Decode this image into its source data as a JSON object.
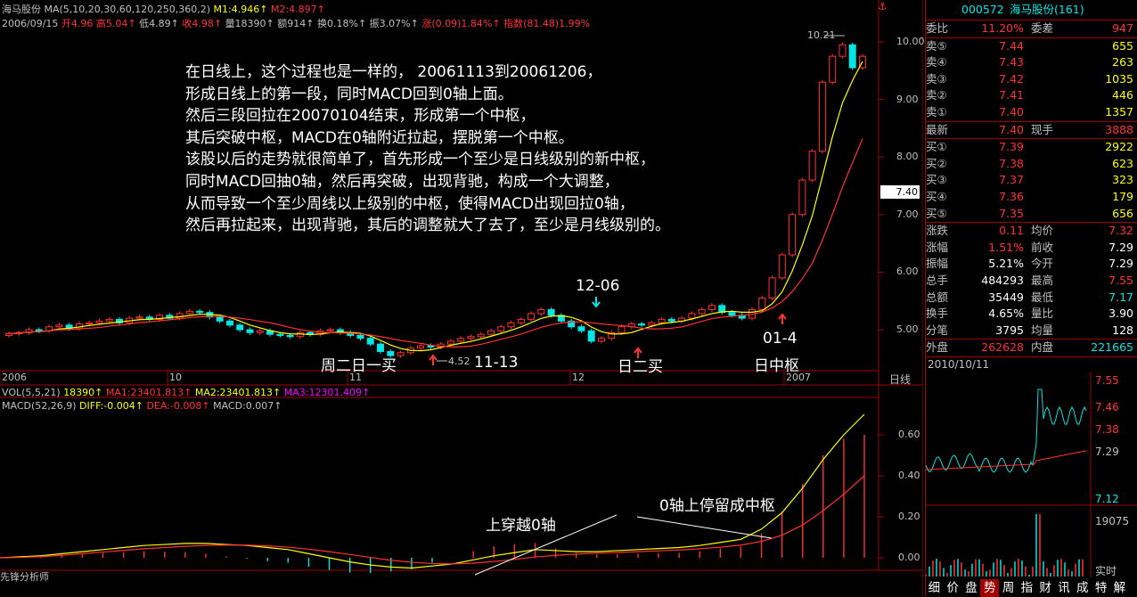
{
  "header": {
    "line1": [
      {
        "t": "海马股份 ",
        "c": "#c0c0c0"
      },
      {
        "t": "MA(5,10,20,30,60,120,250,360,2) ",
        "c": "#c0c0c0"
      },
      {
        "t": "M1:4.946↑ ",
        "c": "#ffff00"
      },
      {
        "t": "M2:4.897↑",
        "c": "#ff3232"
      }
    ],
    "line2": [
      {
        "t": "2006/09/15 ",
        "c": "#c0c0c0"
      },
      {
        "t": "开4.96 ",
        "c": "#ff3232"
      },
      {
        "t": "高5.04↑ ",
        "c": "#ff3232"
      },
      {
        "t": "低4.89↑ ",
        "c": "#c0c0c0"
      },
      {
        "t": "收4.98↑ ",
        "c": "#ff3232"
      },
      {
        "t": "量18390↑ ",
        "c": "#c0c0c0"
      },
      {
        "t": "额914↑ ",
        "c": "#c0c0c0"
      },
      {
        "t": "换0.18%↑ ",
        "c": "#c0c0c0"
      },
      {
        "t": "振3.07%↑ ",
        "c": "#c0c0c0"
      },
      {
        "t": "涨(0.09)1.84%↑ ",
        "c": "#ff3232"
      },
      {
        "t": "指数(81.48)1.99%",
        "c": "#ff3232"
      }
    ],
    "vol": [
      {
        "t": "VOL(5,5,21) ",
        "c": "#c0c0c0"
      },
      {
        "t": "18390↑ ",
        "c": "#ffff00"
      },
      {
        "t": "MA1:23401.813↑ ",
        "c": "#ff3232"
      },
      {
        "t": "MA2:23401.813↑ ",
        "c": "#ffff00"
      },
      {
        "t": "MA3:12301.409↑",
        "c": "#ff00ff"
      }
    ],
    "macd": [
      {
        "t": "MACD(52,26,9) ",
        "c": "#c0c0c0"
      },
      {
        "t": "DIFF:-0.004↑ ",
        "c": "#ffff00"
      },
      {
        "t": "DEA:-0.008↑ ",
        "c": "#ff3232"
      },
      {
        "t": "MACD:0.007↑",
        "c": "#c0c0c0"
      }
    ]
  },
  "annotation_lines": [
    "在日线上，这个过程也是一样的， 20061113到20061206，",
    "形成日线上的第一段，同时MACD回到0轴上面。",
    "然后三段回拉在20070104结束，形成第一个中枢，",
    "其后突破中枢，MACD在0轴附近拉起，摆脱第一个中枢。",
    "该股以后的走势就很简单了，首先形成一个至少是日线级别的新中枢，",
    "同时MACD回抽0轴，然后再突破，出现背驰，构成一个大调整，",
    "从而导致一个至少周线以上级别的中枢，使得MACD出现回拉0轴，",
    "然后再拉起来，出现背驰，其后的调整就大了去了，至少是月线级别的。"
  ],
  "labels": {
    "l1206": "12-06",
    "l1113": "11-13",
    "l014": "01-4",
    "zhou2": "周二日一买",
    "ri2": "日二买",
    "rizs": "日中枢",
    "shang": "上穿越0轴",
    "ting": "0轴上停留成中枢",
    "low": "4.52",
    "high": "10.21",
    "cur": "7.40",
    "period": "日线",
    "soft": "先锋分析师"
  },
  "chart_data": {
    "type": "candlestick",
    "title": "海马股份",
    "x_ticks": [
      "2006",
      "10",
      "11",
      "12",
      "2007"
    ],
    "price_ticks": [
      5.0,
      6.0,
      7.0,
      8.0,
      9.0,
      10.0
    ],
    "price_range": [
      4.52,
      10.21
    ],
    "last_price": 7.4,
    "ma_series": [
      "M1",
      "M2"
    ],
    "candles_close": [
      4.93,
      4.95,
      5.0,
      4.98,
      5.05,
      5.08,
      5.02,
      5.1,
      5.12,
      5.15,
      5.18,
      5.12,
      5.2,
      5.22,
      5.18,
      5.25,
      5.2,
      5.28,
      5.32,
      5.3,
      5.22,
      5.15,
      5.08,
      5.0,
      4.95,
      4.98,
      4.92,
      4.9,
      4.88,
      4.95,
      4.92,
      4.98,
      5.0,
      4.95,
      4.9,
      4.85,
      4.75,
      4.62,
      4.55,
      4.6,
      4.68,
      4.72,
      4.7,
      4.75,
      4.8,
      4.85,
      4.88,
      4.92,
      4.98,
      5.05,
      5.12,
      5.18,
      5.28,
      5.35,
      5.25,
      5.15,
      5.05,
      4.98,
      4.8,
      4.85,
      4.95,
      5.05,
      5.1,
      5.08,
      5.12,
      5.18,
      5.15,
      5.2,
      5.28,
      5.35,
      5.42,
      5.3,
      5.25,
      5.2,
      5.35,
      5.55,
      5.9,
      6.3,
      7.0,
      7.6,
      8.1,
      9.3,
      9.75,
      9.95,
      9.55,
      9.75
    ],
    "macd_ticks": [
      0.0,
      0.2,
      0.4,
      0.6
    ],
    "macd_diff": [
      0.0,
      0.005,
      0.01,
      0.02,
      0.03,
      0.04,
      0.05,
      0.06,
      0.065,
      0.07,
      0.07,
      0.065,
      0.06,
      0.05,
      0.04,
      0.02,
      0.0,
      -0.02,
      -0.035,
      -0.045,
      -0.05,
      -0.04,
      -0.03,
      -0.01,
      0.01,
      0.025,
      0.04,
      0.035,
      0.03,
      0.03,
      0.035,
      0.04,
      0.045,
      0.05,
      0.06,
      0.075,
      0.09,
      0.14,
      0.22,
      0.34,
      0.48,
      0.6,
      0.7
    ],
    "macd_dea": [
      0.0,
      0.002,
      0.006,
      0.012,
      0.02,
      0.028,
      0.036,
      0.044,
      0.05,
      0.056,
      0.06,
      0.062,
      0.062,
      0.058,
      0.052,
      0.042,
      0.03,
      0.016,
      0.002,
      -0.012,
      -0.022,
      -0.028,
      -0.03,
      -0.026,
      -0.018,
      -0.008,
      0.004,
      0.012,
      0.018,
      0.022,
      0.026,
      0.03,
      0.034,
      0.038,
      0.044,
      0.052,
      0.062,
      0.08,
      0.11,
      0.16,
      0.23,
      0.31,
      0.4
    ]
  },
  "right_panel": {
    "code": "000572",
    "name": "海马股份(161)",
    "weibi_label": "委比",
    "weibi": "11.20%",
    "weicha_label": "委差",
    "weicha": "947",
    "sells": [
      {
        "k": "卖⑤",
        "p": "7.44",
        "v": "655"
      },
      {
        "k": "卖④",
        "p": "7.43",
        "v": "263"
      },
      {
        "k": "卖③",
        "p": "7.42",
        "v": "1035"
      },
      {
        "k": "卖②",
        "p": "7.41",
        "v": "446"
      },
      {
        "k": "卖①",
        "p": "7.40",
        "v": "1357"
      }
    ],
    "latest_label": "最新",
    "latest": "7.40",
    "xianshou_label": "现手",
    "xianshou": "3888",
    "buys": [
      {
        "k": "买①",
        "p": "7.39",
        "v": "2922"
      },
      {
        "k": "买②",
        "p": "7.38",
        "v": "623"
      },
      {
        "k": "买③",
        "p": "7.37",
        "v": "323"
      },
      {
        "k": "买④",
        "p": "7.36",
        "v": "179"
      },
      {
        "k": "买⑤",
        "p": "7.35",
        "v": "656"
      }
    ],
    "stats": [
      {
        "k": "涨跌",
        "v": "0.11",
        "vc": "red",
        "k2": "均价",
        "v2": "7.32",
        "v2c": "red"
      },
      {
        "k": "涨幅",
        "v": "1.51%",
        "vc": "red",
        "k2": "前收",
        "v2": "7.29",
        "v2c": "wht"
      },
      {
        "k": "振幅",
        "v": "5.21%",
        "vc": "wht",
        "k2": "今开",
        "v2": "7.29",
        "v2c": "wht"
      },
      {
        "k": "总手",
        "v": "484293",
        "vc": "wht",
        "k2": "最高",
        "v2": "7.55",
        "v2c": "red"
      },
      {
        "k": "总额",
        "v": "35449",
        "vc": "wht",
        "k2": "最低",
        "v2": "7.17",
        "v2c": "grn"
      },
      {
        "k": "换手",
        "v": "4.65%",
        "vc": "wht",
        "k2": "量比",
        "v2": "3.90",
        "v2c": "wht"
      },
      {
        "k": "分笔",
        "v": "3795",
        "vc": "wht",
        "k2": "均量",
        "v2": "128",
        "v2c": "wht"
      }
    ],
    "waipan_label": "外盘",
    "waipan": "262628",
    "neipan_label": "内盘",
    "neipan": "221665",
    "mini_date": "2010/10/11",
    "mini_ticks": [
      "7.55",
      "7.46",
      "7.38",
      "7.29",
      "7.12"
    ],
    "mini_vol": "19075",
    "mini_rt": "实时",
    "bottom_tabs": [
      "细",
      "价",
      "盘",
      "势",
      "周",
      "指",
      "财",
      "讯",
      "成",
      "特",
      "解"
    ]
  }
}
